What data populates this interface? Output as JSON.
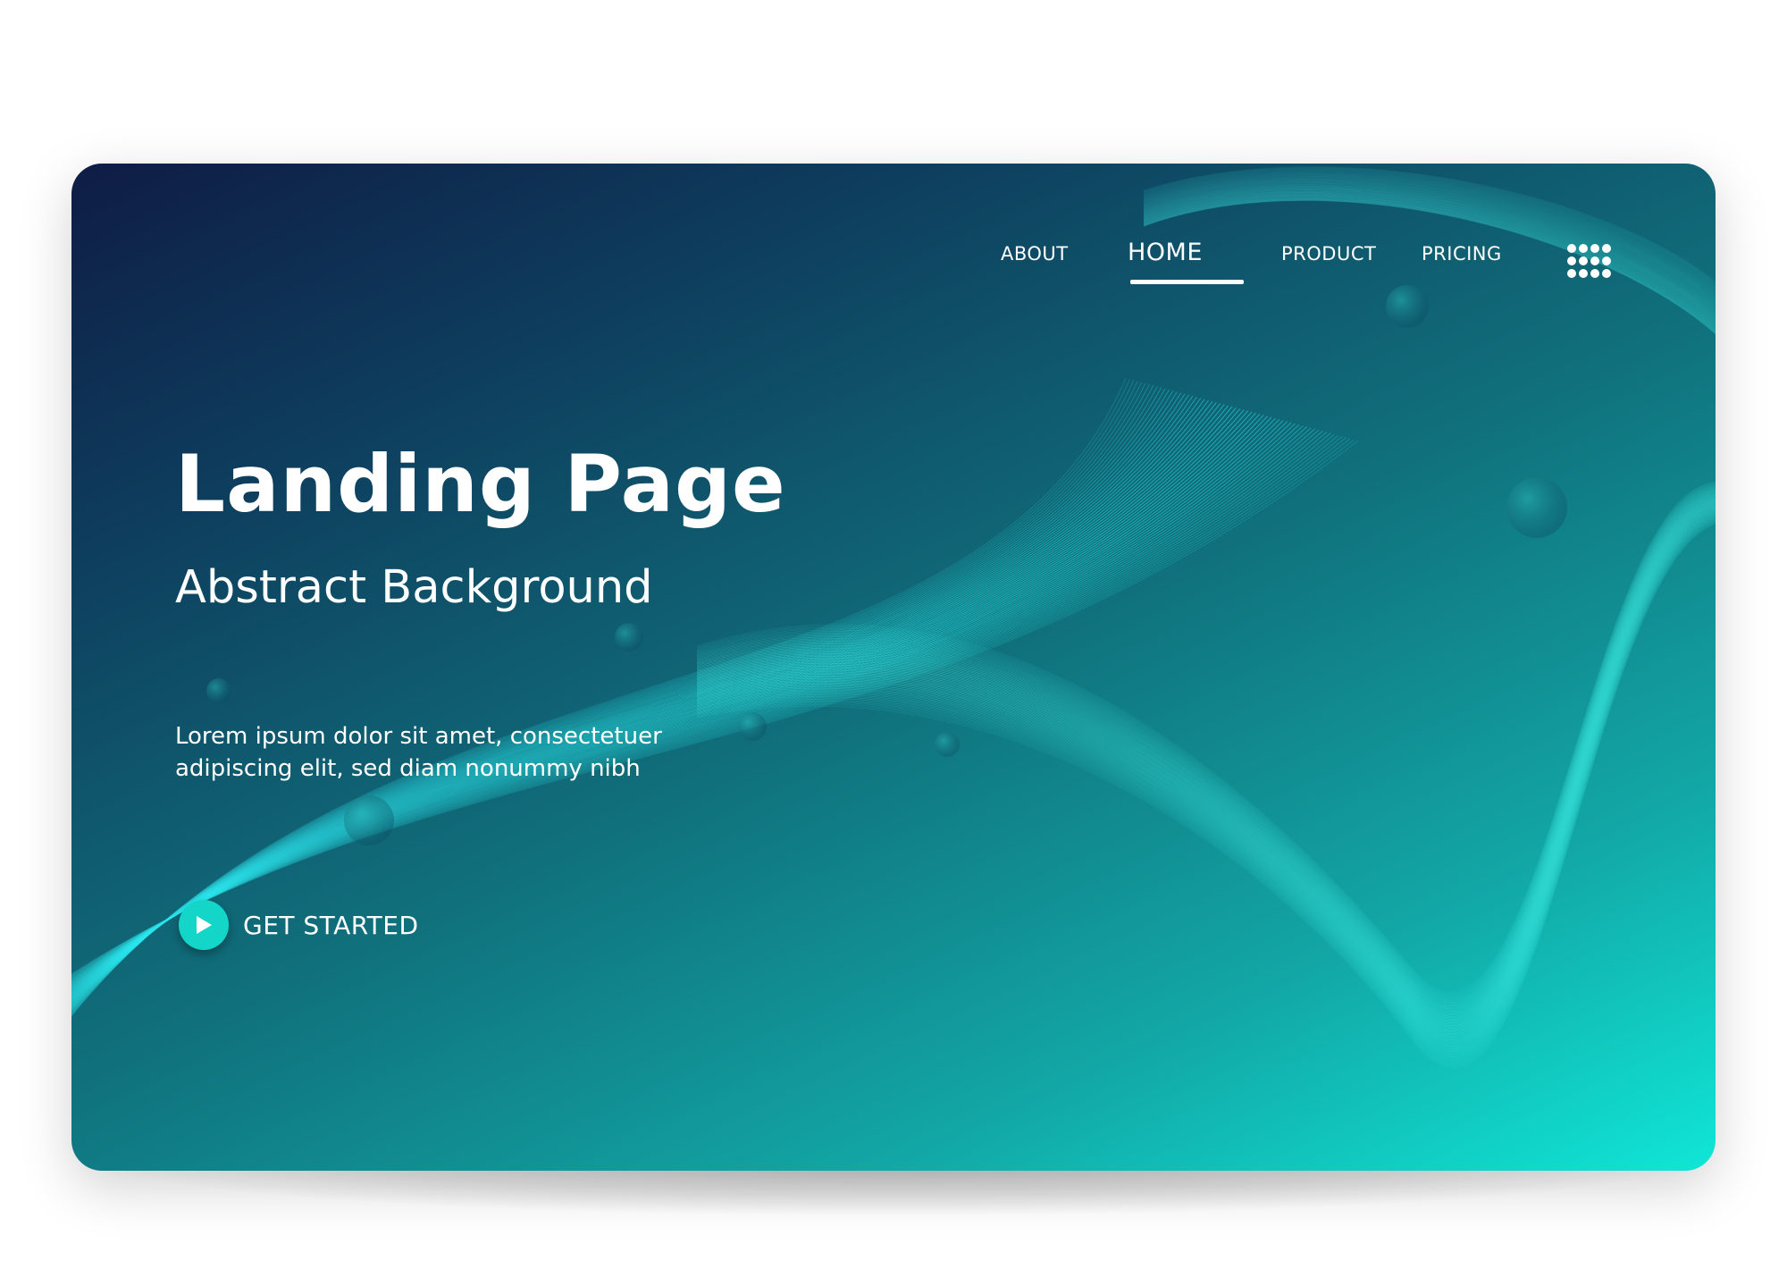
{
  "nav": {
    "items": [
      {
        "label": "ABOUT"
      },
      {
        "label": "HOME"
      },
      {
        "label": "PRODUCT"
      },
      {
        "label": "PRICING"
      }
    ],
    "active": "HOME",
    "menu_icon": "grid-dots-icon"
  },
  "hero": {
    "title": "Landing Page",
    "subtitle": "Abstract Background",
    "body": "Lorem ipsum dolor sit amet, consectetuer adipiscing elit, sed diam nonummy nibh",
    "cta_label": "GET STARTED",
    "cta_icon": "play-icon"
  },
  "colors": {
    "gradient_start": "#0f1c45",
    "gradient_mid": "#10717c",
    "gradient_end": "#10e6d6",
    "accent": "#13d6c8",
    "text": "#ffffff"
  }
}
